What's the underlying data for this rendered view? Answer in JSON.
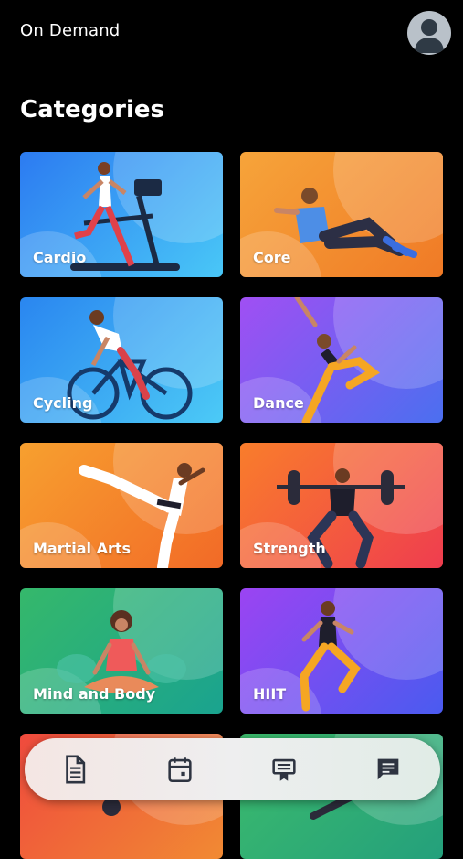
{
  "header": {
    "title": "On Demand",
    "avatar_icon": "user-avatar-icon"
  },
  "section": {
    "title": "Categories"
  },
  "categories": [
    {
      "label": "Cardio",
      "icon": "cardio-illustration",
      "colors": [
        "#2c7bf1",
        "#49c7f7"
      ]
    },
    {
      "label": "Core",
      "icon": "core-illustration",
      "colors": [
        "#f6a43a",
        "#f07a26"
      ]
    },
    {
      "label": "Cycling",
      "icon": "cycling-illustration",
      "colors": [
        "#2a86f0",
        "#4ccaf6"
      ]
    },
    {
      "label": "Dance",
      "icon": "dance-illustration",
      "colors": [
        "#a04ff3",
        "#4b6ff0"
      ]
    },
    {
      "label": "Martial Arts",
      "icon": "martial-arts-illustration",
      "colors": [
        "#f7a02f",
        "#f26a27"
      ]
    },
    {
      "label": "Strength",
      "icon": "strength-illustration",
      "colors": [
        "#f97d2b",
        "#ef3d4f"
      ]
    },
    {
      "label": "Mind and Body",
      "icon": "meditation-illustration",
      "colors": [
        "#35b86b",
        "#1aa38f"
      ]
    },
    {
      "label": "HIIT",
      "icon": "hiit-illustration",
      "colors": [
        "#9b44f2",
        "#4a5bf0"
      ]
    },
    {
      "label": "",
      "icon": "partial-card-illustration",
      "colors": [
        "#ef4a3d",
        "#f18a33"
      ]
    },
    {
      "label": "",
      "icon": "partial-card-illustration",
      "colors": [
        "#3cbb6c",
        "#24a07c"
      ]
    }
  ],
  "bottom_nav": [
    {
      "name": "document-icon"
    },
    {
      "name": "calendar-icon"
    },
    {
      "name": "certificate-icon"
    },
    {
      "name": "chat-icon"
    }
  ]
}
